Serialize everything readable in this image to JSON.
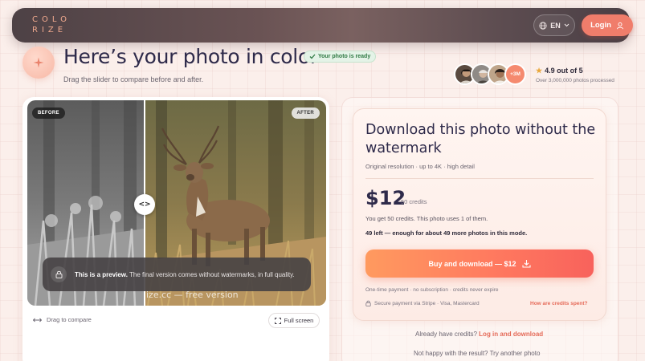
{
  "header": {
    "logo_line1": "COLO",
    "logo_line2": "RIZE",
    "language": "EN",
    "login_label": "Login"
  },
  "hero": {
    "title": "Here’s your photo in color",
    "ready_badge": "Your photo is ready",
    "subtitle": "Drag the slider to compare before and after.",
    "avatar_count": "+3M",
    "rating_text": "4.9 out of 5",
    "rating_sub": "Over 3,000,000 photos processed"
  },
  "compare": {
    "before_label": "BEFORE",
    "after_label": "AFTER",
    "handle_glyph": "<>",
    "watermark": "ize.cc — free version",
    "preview_bold": "This is a preview.",
    "preview_rest": " The final version comes without watermarks, in full quality.",
    "drag_hint": "Drag to compare",
    "fullscreen_label": "Full screen"
  },
  "purchase": {
    "title": "Download this photo without the watermark",
    "meta": "Original resolution · up to 4K · high detail",
    "price": "$12",
    "credits": "50 credits",
    "credits_note": "You get 50 credits. This photo uses 1 of them.",
    "credits_left": "49 left — enough for about 49 more photos in this mode.",
    "buy_label": "Buy and download — $12",
    "payment_note": "One-time payment · no subscription · credits never expire",
    "secure_note": "Secure payment via Stripe · Visa, Mastercard",
    "credits_link": "How are credits spent?",
    "already_text": "Already have credits?",
    "already_link": "Log in and download",
    "not_happy": "Not happy with the result? Try another photo"
  },
  "colors": {
    "accent": "#f07d6b",
    "title": "#2e2a4a",
    "ready_green": "#2f7a44"
  }
}
